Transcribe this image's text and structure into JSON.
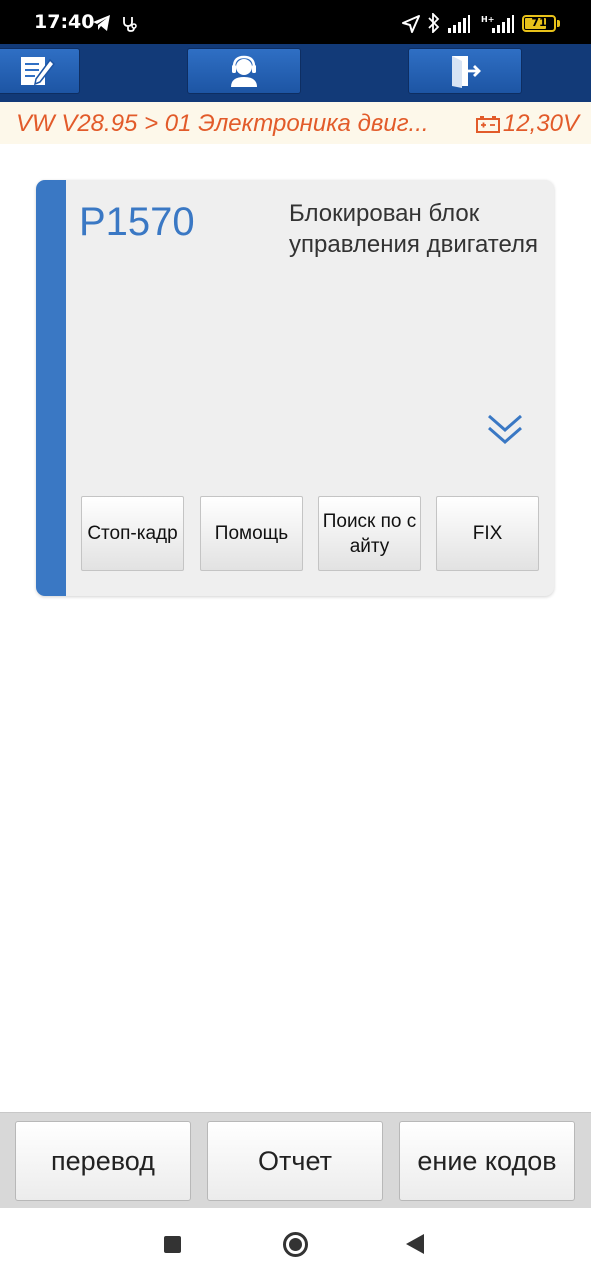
{
  "status_bar": {
    "time": "17:40",
    "battery_level": "71",
    "battery_fraction": 0.71,
    "icons": [
      "telegram-icon",
      "stethoscope-icon",
      "location-icon",
      "bluetooth-icon",
      "signal-icon",
      "signal-hplus-icon",
      "battery-icon"
    ]
  },
  "toolbar": {
    "buttons": [
      "edit-icon",
      "support-agent-icon",
      "exit-icon"
    ]
  },
  "path_bar": {
    "path": "VW V28.95 > 01 Электроника двиг...",
    "voltage": "12,30V",
    "text_color": "#e25b2a"
  },
  "dtc": {
    "code": "P1570",
    "description": "Блокирован блок управления двигателя",
    "accent_color": "#3a78c4",
    "buttons": {
      "freeze_frame": "Стоп-кадр",
      "help": "Помощь",
      "site_search": "Поиск по сайту",
      "fix": "FIX"
    }
  },
  "bottom_buttons": {
    "translate": "перевод",
    "report": "Отчет",
    "clear_codes": "ение кодов"
  }
}
